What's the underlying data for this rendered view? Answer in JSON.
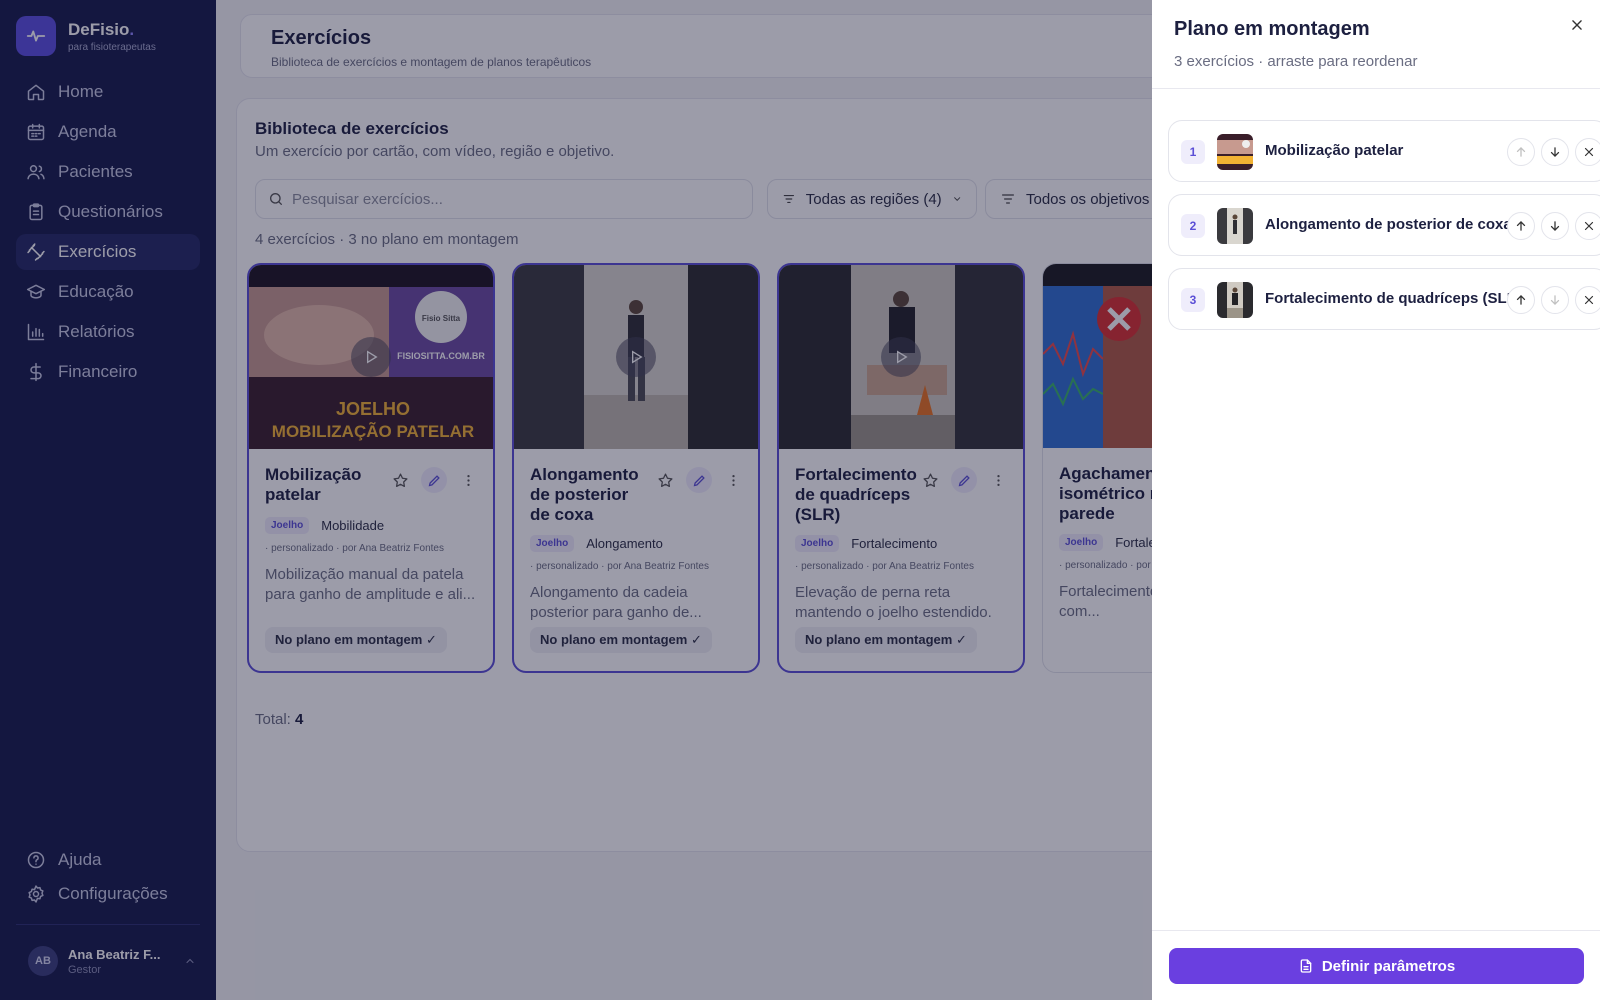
{
  "brand": {
    "name": "DeFisio",
    "dot": ".",
    "subtitle": "para fisioterapeutas"
  },
  "nav": [
    {
      "label": "Home",
      "icon": "home-icon",
      "active": false
    },
    {
      "label": "Agenda",
      "icon": "calendar-icon",
      "active": false
    },
    {
      "label": "Pacientes",
      "icon": "users-icon",
      "active": false
    },
    {
      "label": "Questionários",
      "icon": "clipboard-icon",
      "active": false
    },
    {
      "label": "Exercícios",
      "icon": "dumbbell-icon",
      "active": true
    },
    {
      "label": "Educação",
      "icon": "graduation-cap-icon",
      "active": false
    },
    {
      "label": "Relatórios",
      "icon": "bar-chart-icon",
      "active": false
    },
    {
      "label": "Financeiro",
      "icon": "dollar-icon",
      "active": false
    }
  ],
  "nav_bottom": [
    {
      "label": "Ajuda",
      "icon": "help-circle-icon"
    },
    {
      "label": "Configurações",
      "icon": "gear-icon"
    }
  ],
  "user": {
    "initials": "AB",
    "name": "Ana Beatriz F...",
    "role": "Gestor"
  },
  "header": {
    "title": "Exercícios",
    "subtitle": "Biblioteca de exercícios e montagem de planos terapêuticos"
  },
  "library": {
    "title": "Biblioteca de exercícios",
    "subtitle": "Um exercício por cartão, com vídeo, região e objetivo.",
    "search_placeholder": "Pesquisar exercícios...",
    "filter_regions": "Todas as regiões (4)",
    "filter_objectives": "Todos os objetivos (",
    "count_line": "4 exercícios · 3 no plano em montagem",
    "total_label": "Total:",
    "total_value": "4"
  },
  "exercises": [
    {
      "title": "Mobilização patelar",
      "region": "Joelho",
      "objective": "Mobilidade",
      "meta": "· personalizado · por Ana Beatriz Fontes",
      "desc": "Mobilização manual da patela para ganho de amplitude e ali...",
      "in_plan": "No plano em montagem ✓",
      "thumb_line1": "FISIOSITTA.COM.BR",
      "thumb_line2": "JOELHO",
      "thumb_line3": "MOBILIZAÇÃO PATELAR",
      "thumb_brand": "Fisio Sitta"
    },
    {
      "title": "Alongamento de posterior de coxa",
      "region": "Joelho",
      "objective": "Alongamento",
      "meta": "· personalizado · por Ana Beatriz Fontes",
      "desc": "Alongamento da cadeia posterior para ganho de...",
      "in_plan": "No plano em montagem ✓"
    },
    {
      "title": "Fortalecimento de quadríceps (SLR)",
      "region": "Joelho",
      "objective": "Fortalecimento",
      "meta": "· personalizado · por Ana Beatriz Fontes",
      "desc": "Elevação de perna reta mantendo o joelho estendido.",
      "in_plan": "No plano em montagem ✓"
    },
    {
      "title": "Agachamento isométrico na parede",
      "region": "Joelho",
      "objective": "Fortalecimento",
      "meta": "· personalizado · por Ana Beatriz Fontes",
      "desc": "Fortalecimento de quadríceps com...",
      "in_plan": ""
    }
  ],
  "drawer": {
    "title": "Plano em montagem",
    "subtitle": "3 exercícios · arraste para reordenar",
    "items": [
      {
        "num": "1",
        "name": "Mobilização patelar"
      },
      {
        "num": "2",
        "name": "Alongamento de posterior de coxa"
      },
      {
        "num": "3",
        "name": "Fortalecimento de quadríceps (SLR)"
      }
    ],
    "primary_label": "Definir parâmetros"
  },
  "colors": {
    "sidebar": "#161a4a",
    "accent": "#5b4fd6",
    "primary_button": "#6a3fe0"
  }
}
